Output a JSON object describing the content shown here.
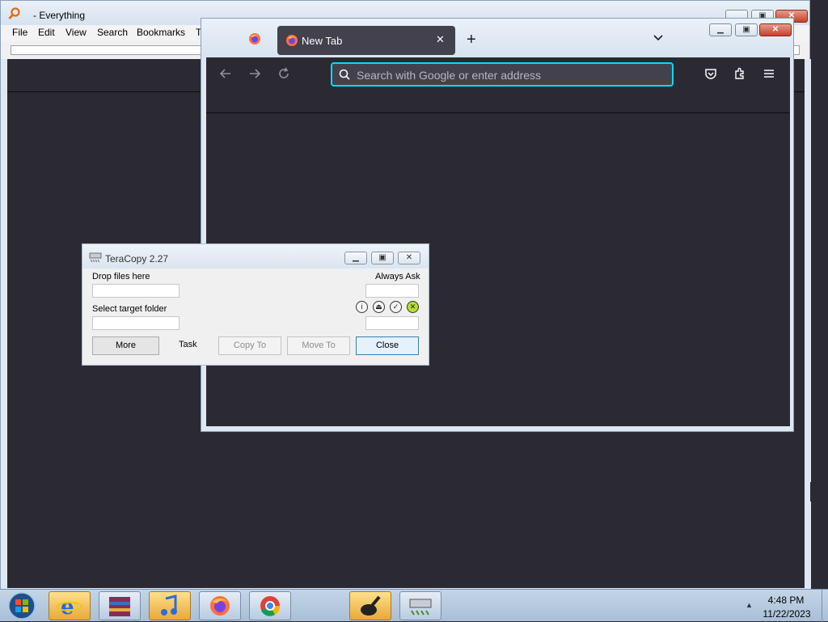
{
  "everything": {
    "title": "- Everything",
    "menu": [
      "File",
      "Edit",
      "View",
      "Search",
      "Bookmarks",
      "T"
    ],
    "caption_buttons": {
      "minimize": "minimize-icon",
      "maximize": "maximize-icon",
      "close": "close-icon"
    }
  },
  "firefox": {
    "tab_label": "New Tab",
    "tab_close": "✕",
    "new_tab": "+",
    "tab_list": "⌄",
    "url_placeholder": "Search with Google or enter address",
    "toolbar_icons": [
      "back-icon",
      "forward-icon",
      "reload-icon",
      "pocket-icon",
      "extensions-icon",
      "menu-icon"
    ]
  },
  "teracopy": {
    "title": "TeraCopy 2.27",
    "drop_label": "Drop files here",
    "target_label": "Select target folder",
    "always_ask": "Always Ask",
    "task_label": "Task",
    "buttons": {
      "more": "More",
      "copy": "Copy To",
      "move": "Move To",
      "close": "Close"
    },
    "status_icons": [
      "info-icon",
      "eject-icon",
      "check-icon",
      "cancel-icon"
    ]
  },
  "taskbar": {
    "apps": [
      "internet-explorer-icon",
      "winrar-icon",
      "itunes-icon",
      "firefox-icon",
      "chrome-icon",
      "blank-app",
      "paint-app-icon",
      "teracopy-icon"
    ],
    "time": "4:48 PM",
    "date": "11/22/2023"
  },
  "colors": {
    "accent": "#00ddff",
    "dark_bg": "#2b2a33",
    "tab_bg": "#42414d",
    "cancel_green": "#b6e02a"
  }
}
